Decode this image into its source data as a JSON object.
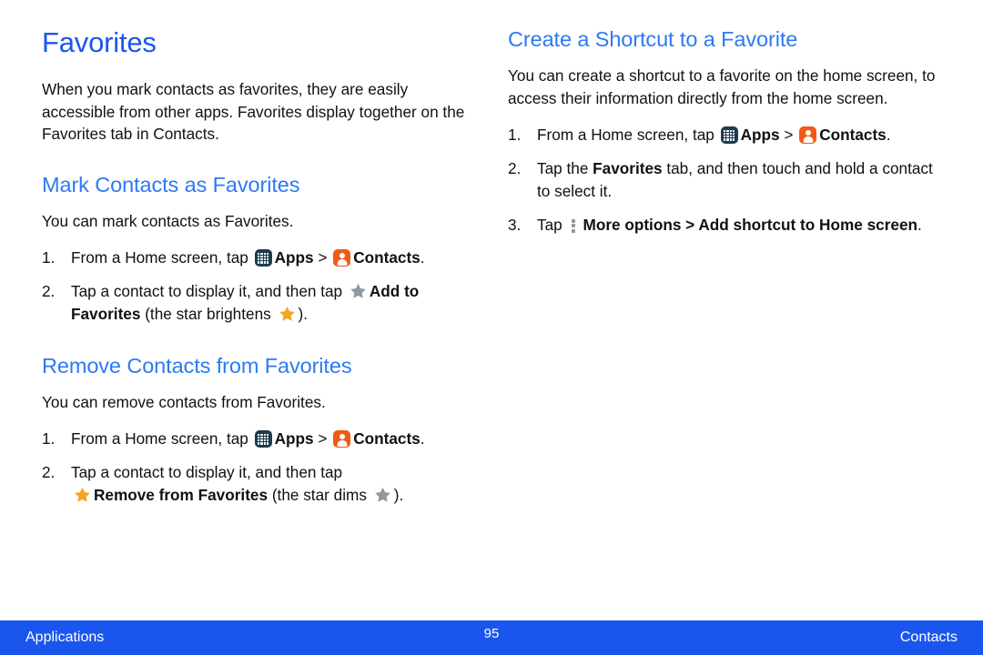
{
  "colors": {
    "title_blue": "#1a56ee",
    "heading_blue": "#2d7af0",
    "footer_blue": "#1a56ee",
    "apps_icon": "#1c3d4f",
    "contacts_icon": "#ef5b16",
    "star_active": "#f5a623",
    "star_dim": "#8b9ba5",
    "more_options_icon": "#8d9aa2"
  },
  "left_column": {
    "title": "Favorites",
    "intro": "When you mark contacts as favorites, they are easily accessible from other apps. Favorites display together on the Favorites tab in Contacts.",
    "sections": [
      {
        "heading": "Mark Contacts as Favorites",
        "intro": "You can mark contacts as Favorites.",
        "steps": [
          {
            "number": "1.",
            "parts": [
              {
                "type": "text",
                "value": "From a Home screen, tap "
              },
              {
                "type": "icon",
                "icon": "apps-icon"
              },
              {
                "type": "bold",
                "value": "Apps"
              },
              {
                "type": "text",
                "value": " > "
              },
              {
                "type": "icon",
                "icon": "contacts-icon"
              },
              {
                "type": "bold",
                "value": "Contacts"
              },
              {
                "type": "text",
                "value": "."
              }
            ]
          },
          {
            "number": "2.",
            "parts": [
              {
                "type": "text",
                "value": "Tap a contact to display it, and then tap "
              },
              {
                "type": "icon",
                "icon": "star-dim-icon"
              },
              {
                "type": "bold",
                "value": "Add to Favorites"
              },
              {
                "type": "text",
                "value": " (the star brightens "
              },
              {
                "type": "icon",
                "icon": "star-active-icon"
              },
              {
                "type": "text",
                "value": ")."
              }
            ]
          }
        ]
      },
      {
        "heading": "Remove Contacts from Favorites",
        "intro": "You can remove contacts from Favorites.",
        "steps": [
          {
            "number": "1.",
            "parts": [
              {
                "type": "text",
                "value": "From a Home screen, tap "
              },
              {
                "type": "icon",
                "icon": "apps-icon"
              },
              {
                "type": "bold",
                "value": "Apps"
              },
              {
                "type": "text",
                "value": " > "
              },
              {
                "type": "icon",
                "icon": "contacts-icon"
              },
              {
                "type": "bold",
                "value": "Contacts"
              },
              {
                "type": "text",
                "value": "."
              }
            ]
          },
          {
            "number": "2.",
            "parts": [
              {
                "type": "text",
                "value": "Tap a contact to display it, and then tap "
              },
              {
                "type": "break"
              },
              {
                "type": "icon",
                "icon": "star-active-icon"
              },
              {
                "type": "bold",
                "value": "Remove from Favorites"
              },
              {
                "type": "text",
                "value": " (the star dims "
              },
              {
                "type": "icon",
                "icon": "star-dim-icon"
              },
              {
                "type": "text",
                "value": ")."
              }
            ]
          }
        ]
      }
    ]
  },
  "right_column": {
    "sections": [
      {
        "heading": "Create a Shortcut to a Favorite",
        "intro": "You can create a shortcut to a favorite on the home screen, to access their information directly from the home screen.",
        "steps": [
          {
            "number": "1.",
            "parts": [
              {
                "type": "text",
                "value": "From a Home screen, tap "
              },
              {
                "type": "icon",
                "icon": "apps-icon"
              },
              {
                "type": "bold",
                "value": "Apps"
              },
              {
                "type": "text",
                "value": " > "
              },
              {
                "type": "icon",
                "icon": "contacts-icon"
              },
              {
                "type": "bold",
                "value": "Contacts"
              },
              {
                "type": "text",
                "value": "."
              }
            ]
          },
          {
            "number": "2.",
            "parts": [
              {
                "type": "text",
                "value": "Tap the "
              },
              {
                "type": "bold",
                "value": "Favorites"
              },
              {
                "type": "text",
                "value": " tab, and then touch and hold a contact to select it."
              }
            ]
          },
          {
            "number": "3.",
            "parts": [
              {
                "type": "text",
                "value": "Tap "
              },
              {
                "type": "icon",
                "icon": "more-options-icon"
              },
              {
                "type": "bold",
                "value": "More options > Add shortcut to Home screen"
              },
              {
                "type": "text",
                "value": "."
              }
            ]
          }
        ]
      }
    ]
  },
  "footer": {
    "left": "Applications",
    "page_number": "95",
    "right": "Contacts"
  }
}
